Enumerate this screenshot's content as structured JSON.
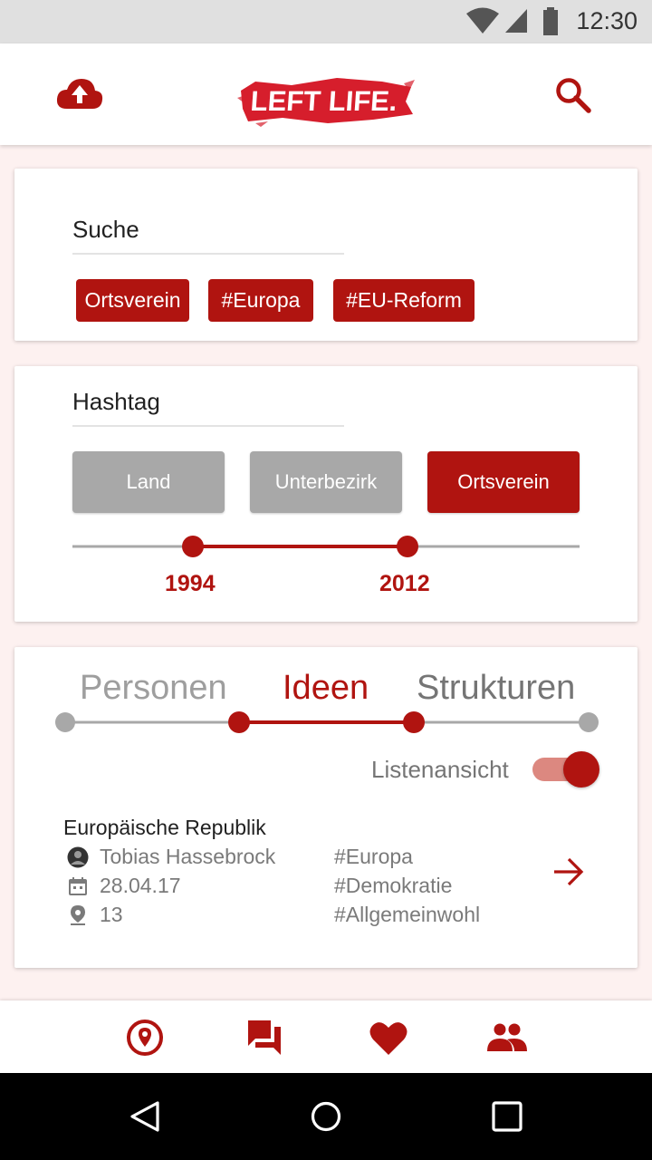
{
  "status_bar": {
    "time": "12:30",
    "icons": [
      "wifi-icon",
      "signal-icon",
      "battery-icon"
    ]
  },
  "app_bar": {
    "logo_text": "LEFT LIFE.",
    "left_icon": "cloud-upload-icon",
    "right_icon": "search-icon"
  },
  "search_card": {
    "label": "Suche",
    "chips": [
      "Ortsverein",
      "#Europa",
      "#EU-Reform"
    ]
  },
  "hashtag_card": {
    "label": "Hashtag",
    "levels": [
      {
        "label": "Land",
        "selected": false
      },
      {
        "label": "Unterbezirk",
        "selected": false
      },
      {
        "label": "Ortsverein",
        "selected": true
      }
    ],
    "year_range": {
      "from": "1994",
      "to": "2012"
    }
  },
  "content_card": {
    "tabs": [
      {
        "label": "Personen",
        "active": false
      },
      {
        "label": "Ideen",
        "active": true
      },
      {
        "label": "Strukturen",
        "active": false
      }
    ],
    "list_toggle": {
      "label": "Listenansicht",
      "on": true
    },
    "item": {
      "title": "Europäische Republik",
      "author": "Tobias Hassebrock",
      "date": "28.04.17",
      "location": "13",
      "tags": [
        "#Europa",
        "#Demokratie",
        "#Allgemeinwohl"
      ]
    }
  },
  "bottom_nav": [
    "place-icon",
    "forum-icon",
    "heart-icon",
    "people-icon"
  ],
  "system_nav": [
    "back-icon",
    "home-icon",
    "recents-icon"
  ],
  "colors": {
    "primary": "#b01410",
    "inactive": "#a8a8a8",
    "background": "#fdf1f0",
    "toggle_track": "#dc8880"
  }
}
